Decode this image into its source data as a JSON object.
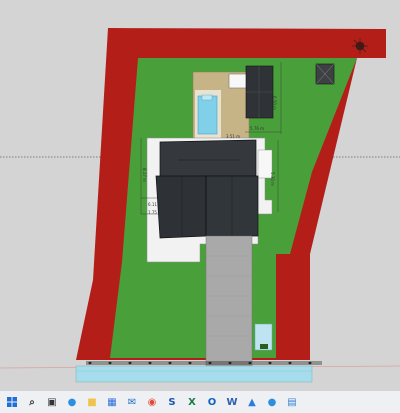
{
  "model": {
    "dimension_labels": [
      "6.50 m",
      "5.76 m",
      "5.30 m",
      "3.51 m",
      "8.17 m",
      "6.11",
      "1.75"
    ],
    "colors": {
      "background": "#d4d4d4",
      "boundary_wall": "#b41e18",
      "lawn": "#49a03a",
      "paving_tan": "#c7b486",
      "pool_water": "#7fd0e8",
      "roof": "#35393d",
      "driveway": "#a9a9a9",
      "terrace": "#f2f2f2",
      "street_water": "#a7dcec"
    }
  },
  "taskbar": {
    "icons": [
      {
        "name": "search-icon",
        "glyph": "⌕"
      },
      {
        "name": "task-view-icon",
        "glyph": "▣"
      },
      {
        "name": "edge-browser-icon",
        "glyph": "●",
        "color": "#2d8fe0"
      },
      {
        "name": "file-explorer-icon",
        "glyph": "■",
        "color": "#f0c44c"
      },
      {
        "name": "calendar-app-icon",
        "glyph": "▦",
        "color": "#2a6dd8"
      },
      {
        "name": "mail-app-icon",
        "glyph": "✉",
        "color": "#1f6fc6"
      },
      {
        "name": "chrome-icon",
        "glyph": "◉",
        "color": "#e04a3a"
      },
      {
        "name": "sketchup-icon",
        "glyph": "S",
        "color": "#1a56b0"
      },
      {
        "name": "excel-icon",
        "glyph": "X",
        "color": "#1e7a45"
      },
      {
        "name": "outlook-icon",
        "glyph": "O",
        "color": "#0b64c0"
      },
      {
        "name": "word-icon",
        "glyph": "W",
        "color": "#2b5fb3"
      },
      {
        "name": "photos-app-icon",
        "glyph": "▲",
        "color": "#2c7be0"
      },
      {
        "name": "media-player-icon",
        "glyph": "●",
        "color": "#2d8fe0"
      },
      {
        "name": "store-icon",
        "glyph": "▤",
        "color": "#3b82d6"
      }
    ]
  }
}
